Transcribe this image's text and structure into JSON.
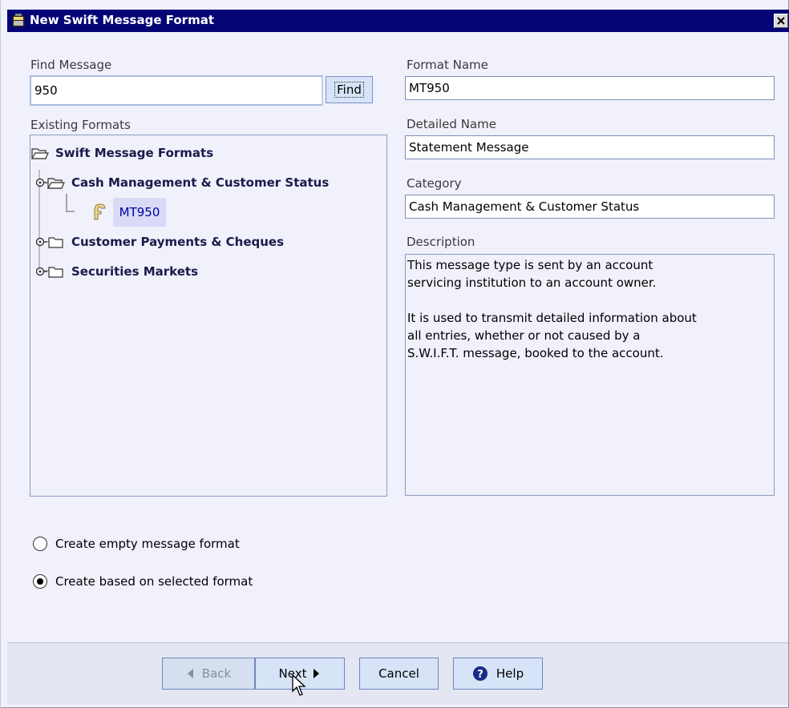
{
  "window": {
    "title": "New Swift Message Format"
  },
  "find": {
    "label": "Find Message",
    "value": "950",
    "button": "Find"
  },
  "tree": {
    "label": "Existing Formats",
    "root": "Swift Message Formats",
    "items": [
      {
        "label": "Cash Management & Customer Status",
        "expanded": true
      },
      {
        "label": "Customer Payments & Cheques",
        "expanded": false
      },
      {
        "label": "Securities Markets",
        "expanded": false
      }
    ],
    "selected_leaf": "MT950"
  },
  "details": {
    "format_name_label": "Format Name",
    "format_name": "MT950",
    "detailed_name_label": "Detailed Name",
    "detailed_name": "Statement Message",
    "category_label": "Category",
    "category": "Cash Management & Customer Status",
    "description_label": "Description",
    "description": "This message type is sent by an account\nservicing institution to an account owner.\n\nIt is used to transmit detailed information about\nall entries, whether or not caused by a\nS.W.I.F.T. message, booked to the account."
  },
  "options": {
    "empty_label": "Create empty message format",
    "based_label": "Create based on selected format",
    "selected": "based"
  },
  "buttons": {
    "back": "Back",
    "next": "Next",
    "cancel": "Cancel",
    "help": "Help"
  },
  "colors": {
    "titlebar": "#040476",
    "window_bg": "#f0f1fb",
    "button_bg": "#d7e4f7",
    "selection": "#d8daf6"
  }
}
